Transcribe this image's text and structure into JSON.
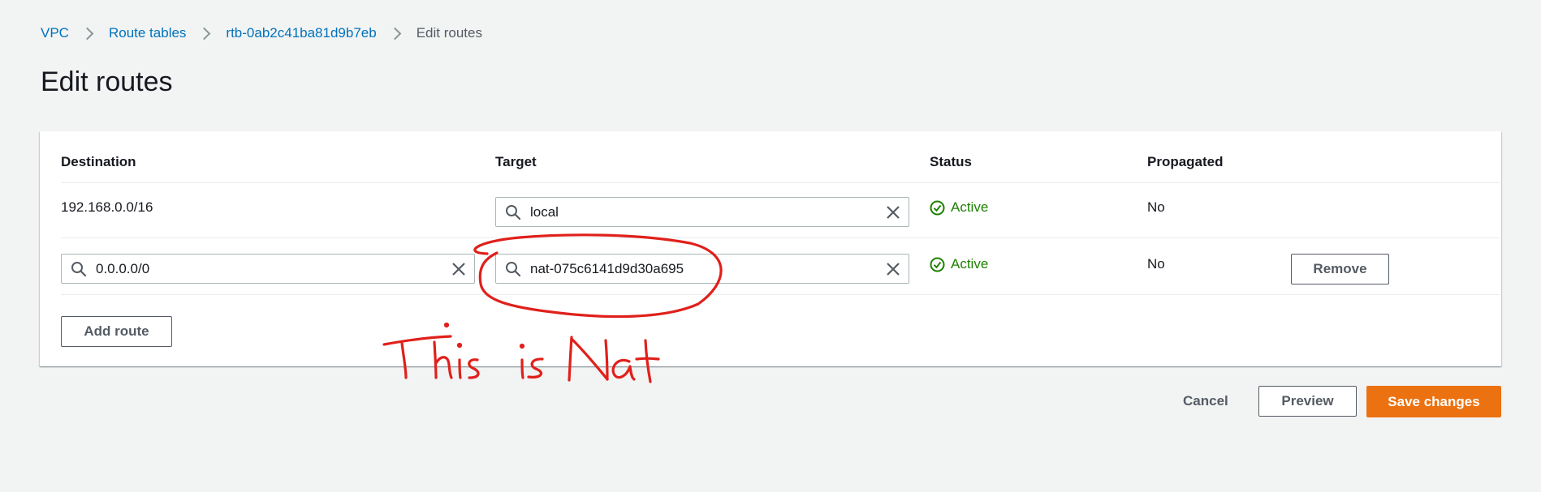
{
  "breadcrumb": {
    "items": [
      "VPC",
      "Route tables",
      "rtb-0ab2c41ba81d9b7eb"
    ],
    "current": "Edit routes"
  },
  "page": {
    "title": "Edit routes"
  },
  "table": {
    "columns": [
      "Destination",
      "Target",
      "Status",
      "Propagated"
    ],
    "rows": [
      {
        "destination": "192.168.0.0/16",
        "target": "local",
        "status": "Active",
        "propagated": "No"
      },
      {
        "destination": "0.0.0.0/0",
        "target": "nat-075c6141d9d30a695",
        "status": "Active",
        "propagated": "No",
        "remove_label": "Remove"
      }
    ],
    "add_route_label": "Add route"
  },
  "actions": {
    "cancel": "Cancel",
    "preview": "Preview",
    "save": "Save changes"
  },
  "annotation": {
    "text": "This is Nat",
    "color": "#e0201b",
    "shape": "hand-drawn-ellipse-around-nat-target"
  },
  "colors": {
    "primary": "#ec7211",
    "link": "#0073bb",
    "success": "#1d8102"
  }
}
